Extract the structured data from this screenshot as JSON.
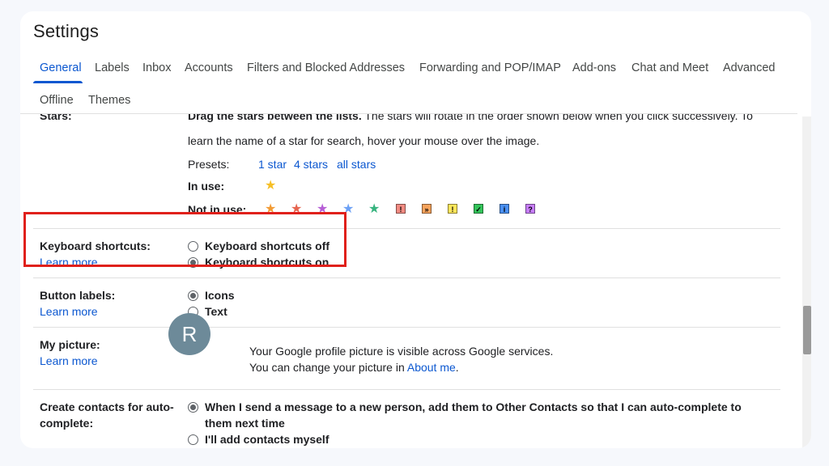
{
  "title": "Settings",
  "tabs": [
    "General",
    "Labels",
    "Inbox",
    "Accounts",
    "Filters and Blocked Addresses",
    "Forwarding and POP/IMAP",
    "Add-ons",
    "Chat and Meet",
    "Advanced",
    "Offline",
    "Themes"
  ],
  "stars": {
    "cut_text_1": "Drag the stars between the lists.",
    "cut_text_2": "The stars will rotate in the order shown below when you click successively. To",
    "desc_line2": "learn the name of a star for search, hover your mouse over the image.",
    "presets_label": "Presets:",
    "presets": [
      "1 star",
      "4 stars",
      "all stars"
    ],
    "in_use_label": "In use:",
    "not_in_use_label": "Not in use:",
    "icons": [
      "yellow-star",
      "orange-star",
      "red-star",
      "purple-star",
      "blue-star",
      "green-star",
      "red-bang",
      "orange-guillemet",
      "yellow-bang",
      "green-check",
      "blue-info",
      "purple-question"
    ]
  },
  "keyboard": {
    "label": "Keyboard shortcuts:",
    "learn_more": "Learn more",
    "off": "Keyboard shortcuts off",
    "on": "Keyboard shortcuts on",
    "selected": "on"
  },
  "button_labels": {
    "label": "Button labels:",
    "learn_more": "Learn more",
    "icons": "Icons",
    "text": "Text",
    "selected": "icons"
  },
  "picture": {
    "label": "My picture:",
    "learn_more": "Learn more",
    "avatar_letter": "R",
    "line1": "Your Google profile picture is visible across Google services.",
    "line2_prefix": "You can change your picture in",
    "about_me": "About me",
    "line2_suffix": "."
  },
  "contacts": {
    "label_1": "Create contacts for auto-",
    "label_2": "complete:",
    "opt1_line1": "When I send a message to a new person, add them to Other Contacts so that I can auto-complete to",
    "opt1_line2": "them next time",
    "opt2": "I'll add contacts myself",
    "selected": "auto"
  },
  "colors": {
    "accent": "#0b57d0",
    "highlight": "#e0201b"
  }
}
